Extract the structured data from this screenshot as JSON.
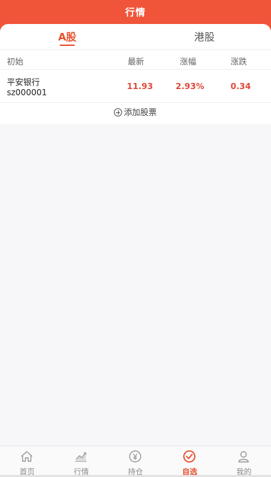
{
  "header": {
    "title": "行情"
  },
  "tabs": [
    {
      "label": "A股",
      "active": true
    },
    {
      "label": "港股",
      "active": false
    }
  ],
  "table": {
    "columns": [
      "初始",
      "最新",
      "涨幅",
      "涨跌"
    ],
    "rows": [
      {
        "name": "平安银行",
        "code": "sz000001",
        "latest": "11.93",
        "change_pct": "2.93%",
        "change": "0.34"
      }
    ]
  },
  "add_stock_label": "添加股票",
  "tabbar": [
    {
      "label": "首页",
      "icon": "home-icon",
      "active": false
    },
    {
      "label": "行情",
      "icon": "chart-icon",
      "active": false
    },
    {
      "label": "持仓",
      "icon": "yen-icon",
      "active": false
    },
    {
      "label": "自选",
      "icon": "check-circle-icon",
      "active": true
    },
    {
      "label": "我的",
      "icon": "user-icon",
      "active": false
    }
  ],
  "colors": {
    "brand": "#f0553a",
    "up": "#e04a3b",
    "inactive": "#8a8a8a"
  }
}
